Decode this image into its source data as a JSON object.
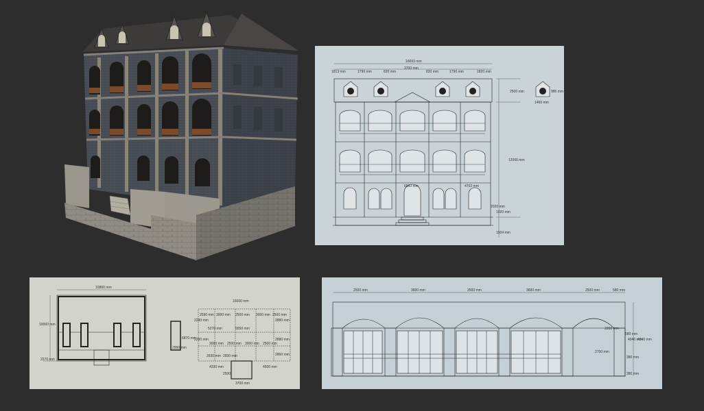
{
  "colors": {
    "background": "#2d2d2d",
    "front_panel": "#c9d3d8",
    "plan_panel": "#d2d3cd",
    "arcade_panel": "#c5d0d6",
    "brick": "#4a4f58",
    "roof": "#3d3a3a",
    "stone": "#8f8c84"
  },
  "front_elevation": {
    "top_dims": [
      "1813 mm",
      "1790 mm",
      "820 mm",
      "3700 mm",
      "820 mm",
      "1790 mm",
      "1820 mm"
    ],
    "overall_width": "16693 mm",
    "right_dims": [
      "2500 mm",
      "12060 mm",
      "2020 mm",
      "1020 mm",
      "1504 mm"
    ],
    "mid_labels": [
      "6060 mm",
      "4702 mm"
    ],
    "dormer_detail": [
      "985 mm",
      "1460 mm"
    ]
  },
  "plans": {
    "left_top": "10860 mm",
    "left_side": "10060 mm",
    "left_bottom": "2276 mm",
    "right_top": "16600 mm",
    "right_rows": [
      "2590 mm",
      "3000 mm",
      "2500 mm",
      "3000 mm",
      "2500 mm"
    ],
    "right_row2": [
      "3000 mm",
      "2500 mm",
      "3000 mm",
      "2500 mm"
    ],
    "right_mid": [
      "5270 mm",
      "5550 mm"
    ],
    "right_side": [
      "2880 mm",
      "2880 mm",
      "2860 mm"
    ],
    "right_left": [
      "2280 mm",
      "2280 mm"
    ],
    "right_lower": [
      "2630 mm",
      "2830 mm",
      "4330 mm",
      "4500 mm"
    ],
    "small_unit": [
      "6870 mm",
      "2990 mm"
    ],
    "bottom": [
      "2500",
      "3700 mm"
    ]
  },
  "arcade": {
    "top_dims": [
      "2500 mm",
      "3600 mm",
      "2500 mm",
      "3600 mm",
      "2500 mm",
      "580 mm"
    ],
    "right_dims": [
      "2200 mm",
      "2700 mm",
      "580 mm",
      "4040 mm",
      "4040 mm",
      "380 mm",
      "380 mm"
    ]
  }
}
